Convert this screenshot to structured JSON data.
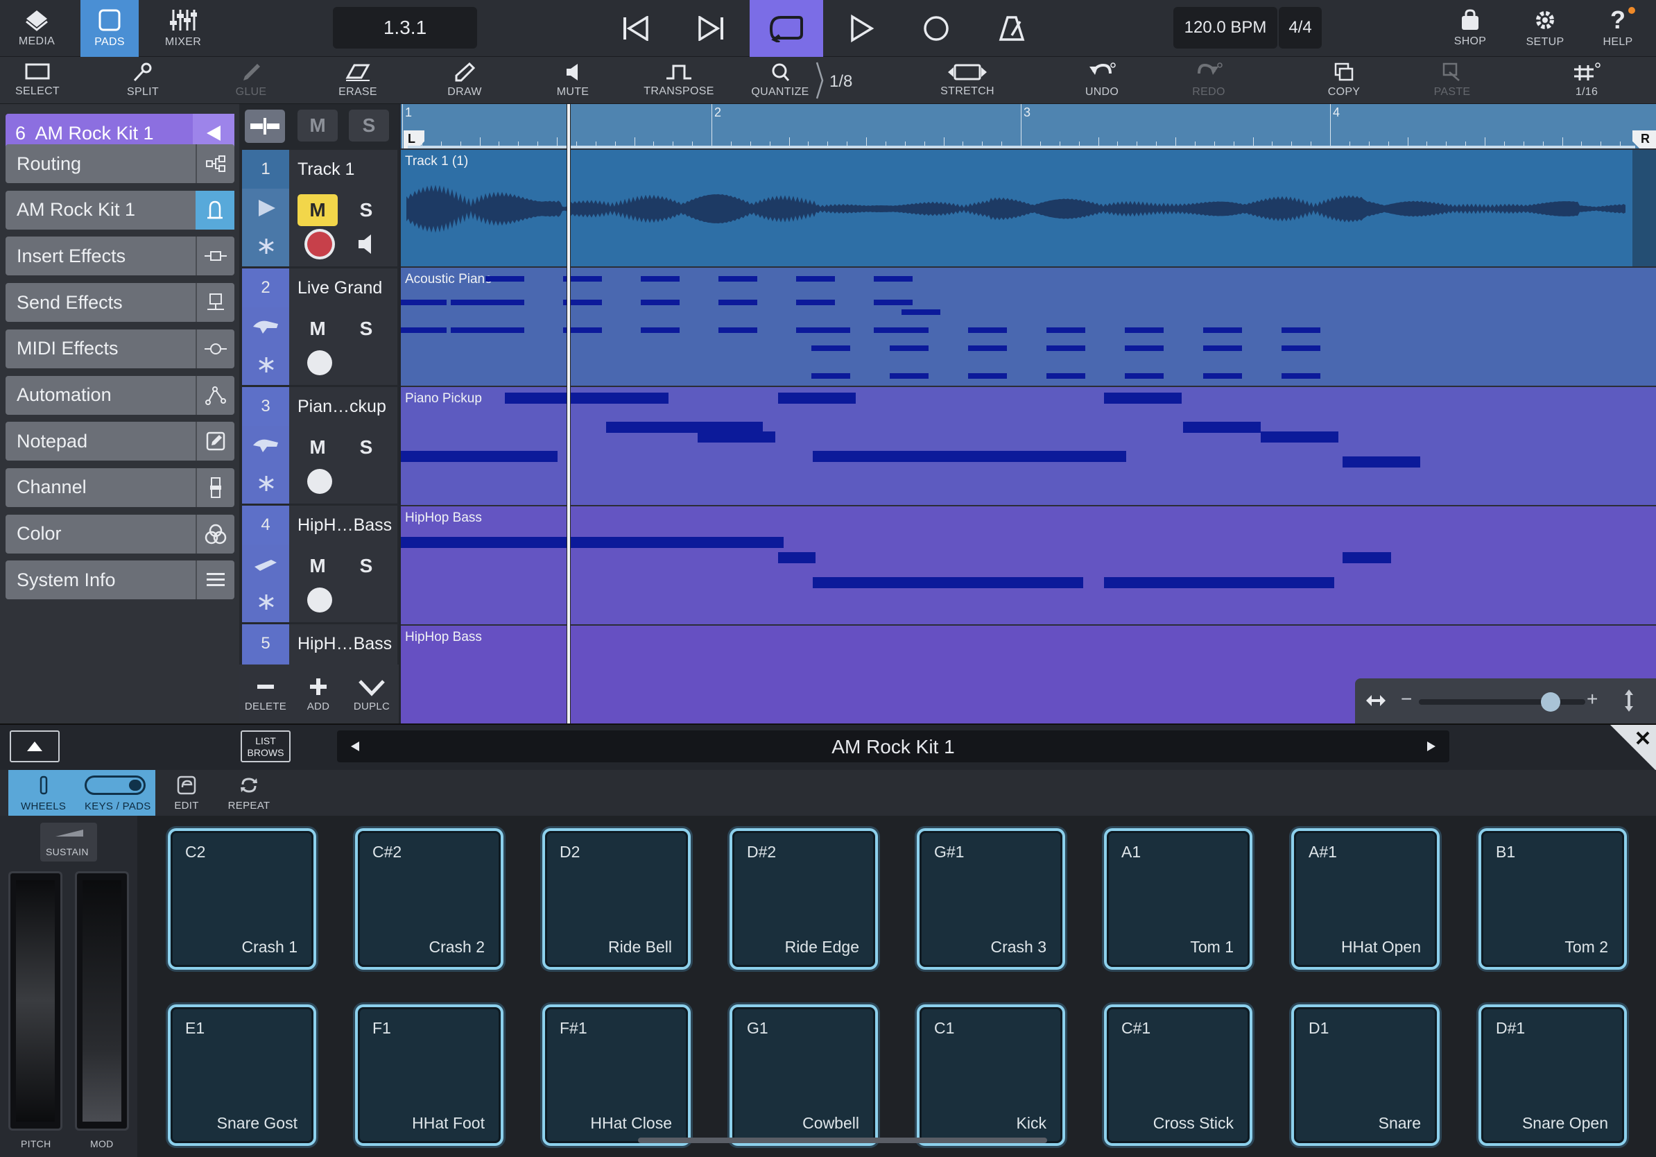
{
  "topbar": {
    "media": "MEDIA",
    "pads": "PADS",
    "mixer": "MIXER",
    "position": "1.3.1",
    "tempo": "120.0 BPM",
    "signature": "4/4",
    "shop": "SHOP",
    "setup": "SETUP",
    "help": "HELP",
    "accent": "#4a8fd4",
    "loop_active_color": "#7b6de6"
  },
  "toolbar": {
    "select": "SELECT",
    "split": "SPLIT",
    "glue": "GLUE",
    "erase": "ERASE",
    "draw": "DRAW",
    "mute": "MUTE",
    "transpose": "TRANSPOSE",
    "quantize": "QUANTIZE",
    "quantize_value": "1/8",
    "stretch": "STRETCH",
    "undo": "UNDO",
    "redo": "REDO",
    "copy": "COPY",
    "paste": "PASTE",
    "grid_value": "1/16"
  },
  "inspector": {
    "selected_track": "6  AM Rock Kit 1",
    "items": [
      {
        "label": "Routing",
        "icon": "routing-icon"
      },
      {
        "label": "AM Rock Kit 1",
        "icon": "instrument-icon"
      },
      {
        "label": "Insert Effects",
        "icon": "insert-effects-icon"
      },
      {
        "label": "Send Effects",
        "icon": "send-effects-icon"
      },
      {
        "label": "MIDI Effects",
        "icon": "midi-effects-icon"
      },
      {
        "label": "Automation",
        "icon": "automation-icon"
      },
      {
        "label": "Notepad",
        "icon": "notepad-icon"
      },
      {
        "label": "Channel",
        "icon": "channel-icon"
      },
      {
        "label": "Color",
        "icon": "color-icon"
      },
      {
        "label": "System Info",
        "icon": "system-info-icon"
      }
    ]
  },
  "tracks": [
    {
      "num": "1",
      "name": "Track 1",
      "lane": "Track 1 (1)",
      "mute": "M",
      "solo": "S"
    },
    {
      "num": "2",
      "name": "Live Grand",
      "lane": "Acoustic Piano",
      "mute": "M",
      "solo": "S"
    },
    {
      "num": "3",
      "name": "Pian…ckup",
      "lane": "Piano Pickup",
      "mute": "M",
      "solo": "S"
    },
    {
      "num": "4",
      "name": "HipH…Bass",
      "lane": "HipHop Bass",
      "mute": "M",
      "solo": "S"
    },
    {
      "num": "5",
      "name": "HipH…Bass",
      "lane": "HipHop Bass"
    }
  ],
  "header_buttons": {
    "mute_all": "M",
    "solo_all": "S"
  },
  "track_actions": {
    "delete": "DELETE",
    "add": "ADD",
    "duplicate": "DUPLC"
  },
  "ruler": {
    "bars": [
      "1",
      "2",
      "3",
      "4"
    ],
    "left_marker": "L",
    "right_marker": "R"
  },
  "instrument_bar": {
    "list_browser": "LIST\nBROWS",
    "name": "AM Rock Kit 1"
  },
  "pad_toolbar": {
    "wheels": "WHEELS",
    "keys_pads": "KEYS / PADS",
    "edit": "EDIT",
    "repeat": "REPEAT",
    "sustain": "SUSTAIN",
    "pitch": "PITCH",
    "mod": "MOD"
  },
  "pads": [
    {
      "note": "C2",
      "label": "Crash 1"
    },
    {
      "note": "C#2",
      "label": "Crash 2"
    },
    {
      "note": "D2",
      "label": "Ride Bell"
    },
    {
      "note": "D#2",
      "label": "Ride Edge"
    },
    {
      "note": "G#1",
      "label": "Crash 3"
    },
    {
      "note": "A1",
      "label": "Tom 1"
    },
    {
      "note": "A#1",
      "label": "HHat Open"
    },
    {
      "note": "B1",
      "label": "Tom 2"
    },
    {
      "note": "E1",
      "label": "Snare Gost"
    },
    {
      "note": "F1",
      "label": "HHat Foot"
    },
    {
      "note": "F#1",
      "label": "HHat Close"
    },
    {
      "note": "G1",
      "label": "Cowbell"
    },
    {
      "note": "C1",
      "label": "Kick"
    },
    {
      "note": "C#1",
      "label": "Cross Stick"
    },
    {
      "note": "D1",
      "label": "Snare"
    },
    {
      "note": "D#1",
      "label": "Snare Open"
    }
  ]
}
